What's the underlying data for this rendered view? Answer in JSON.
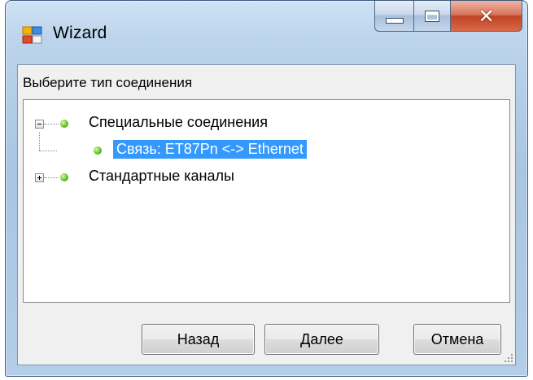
{
  "window": {
    "title": "Wizard"
  },
  "colors": {
    "selection": "#3399ff",
    "node_dot": "#5bb82a",
    "close_button": "#c8492a"
  },
  "icons": {
    "app": "wizard-app-icon",
    "minimize": "minimize-icon",
    "maximize": "maximize-icon",
    "close": "close-icon",
    "collapse": "collapse-icon",
    "expand": "expand-icon",
    "node": "green-dot-icon",
    "grip": "resize-grip-icon"
  },
  "prompt": "Выберите тип соединения",
  "tree": {
    "nodes": [
      {
        "label": "Специальные соединения",
        "expanded": true,
        "children": [
          {
            "label": "Связь: ET87Pn <-> Ethernet",
            "selected": true
          }
        ]
      },
      {
        "label": "Стандартные каналы",
        "expanded": false,
        "children": []
      }
    ]
  },
  "buttons": {
    "back": "Назад",
    "next": "Далее",
    "cancel": "Отмена"
  }
}
